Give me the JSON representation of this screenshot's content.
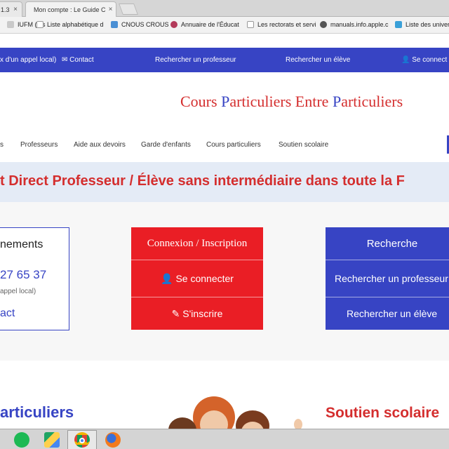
{
  "browser": {
    "tabs": [
      {
        "label": "1.3",
        "close": "×"
      },
      {
        "label": "Mon compte : Le Guide C",
        "close": "×"
      }
    ],
    "bookmarks": [
      {
        "label": "IUFM (Ins",
        "icon": "generic-icon"
      },
      {
        "label": "Liste alphabétique d",
        "icon": "page-icon"
      },
      {
        "label": "CNOUS CROUS",
        "icon": "crous-icon"
      },
      {
        "label": "Annuaire de l'Éducat",
        "icon": "annuaire-icon"
      },
      {
        "label": "Les rectorats et servi",
        "icon": "page-icon"
      },
      {
        "label": "manuals.info.apple.c",
        "icon": "apple-icon"
      },
      {
        "label": "Liste des univers",
        "icon": "link-icon"
      }
    ]
  },
  "topbar": {
    "left_text": "x d'un appel local)",
    "contact": "Contact",
    "search_teacher": "Rechercher un professeur",
    "search_student": "Rechercher un élève",
    "account": "Se connect"
  },
  "site": {
    "title_parts": [
      {
        "text": "Cours ",
        "blue": false
      },
      {
        "text": "P",
        "blue": true
      },
      {
        "text": "articuliers ",
        "blue": false
      },
      {
        "text": "E",
        "blue": false
      },
      {
        "text": "ntre ",
        "blue": false
      },
      {
        "text": "P",
        "blue": true
      },
      {
        "text": "articuliers",
        "blue": false
      }
    ]
  },
  "nav": {
    "items": [
      "s",
      "Professeurs",
      "Aide aux devoirs",
      "Garde d'enfants",
      "Cours particuliers",
      "Soutien scolaire"
    ]
  },
  "banner": {
    "text": "t Direct Professeur / Élève sans intermédiaire dans toute la F"
  },
  "info_box": {
    "title": "nements",
    "phone": "27 65 37",
    "note": "appel local)",
    "contact": "act"
  },
  "account_box": {
    "header": "Connexion / Inscription",
    "login": "Se connecter",
    "register": "S'inscrire",
    "login_icon": "user-icon",
    "register_icon": "edit-icon"
  },
  "search_box": {
    "header": "Recherche",
    "teacher": "Rechercher un professeur",
    "student": "Rechercher un élève"
  },
  "lower": {
    "left_heading": "articuliers",
    "right_heading": "Soutien scolaire"
  },
  "colors": {
    "brand_blue": "#3744c4",
    "brand_red": "#ea1e25",
    "title_red": "#d42e2e"
  }
}
